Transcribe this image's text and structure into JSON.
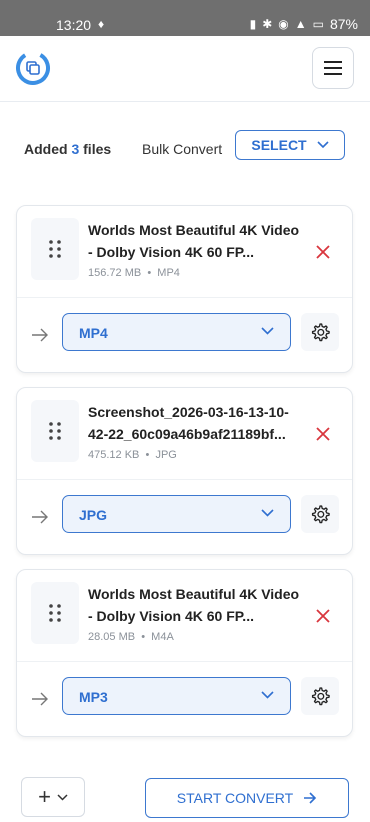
{
  "status_bar": {
    "time": "13:20",
    "battery": "87%"
  },
  "header": {
    "logo_icon": "convert-logo-icon",
    "menu_icon": "hamburger-menu-icon"
  },
  "summary": {
    "added_prefix": "Added",
    "file_count": "3",
    "added_suffix": "files",
    "bulk_label": "Bulk Convert",
    "select_label": "SELECT"
  },
  "files": [
    {
      "name": "Worlds Most Beautiful 4K Video - Dolby Vision 4K 60 FP...",
      "size": "156.72 MB",
      "type": "MP4",
      "format": "MP4"
    },
    {
      "name": "Screenshot_2026-03-16-13-10-42-22_60c09a46b9af21189bf...",
      "size": "475.12 KB",
      "type": "JPG",
      "format": "JPG"
    },
    {
      "name": "Worlds Most Beautiful 4K Video - Dolby Vision 4K 60 FP...",
      "size": "28.05 MB",
      "type": "M4A",
      "format": "MP3"
    }
  ],
  "footer": {
    "add_label": "+",
    "start_label": "START CONVERT"
  },
  "colors": {
    "accent": "#2f6fd0",
    "remove": "#d9363e"
  }
}
